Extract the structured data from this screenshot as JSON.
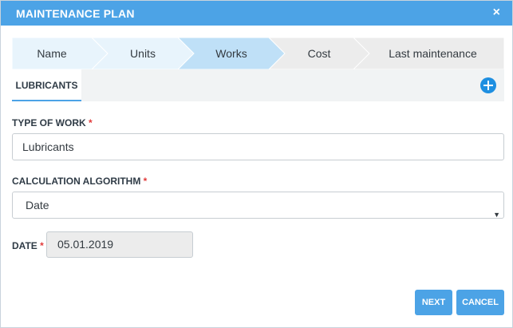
{
  "dialog": {
    "title": "MAINTENANCE PLAN",
    "close_icon": "×"
  },
  "stepper": {
    "steps": [
      {
        "label": "Name",
        "state": "completed"
      },
      {
        "label": "Units",
        "state": "completed"
      },
      {
        "label": "Works",
        "state": "active"
      },
      {
        "label": "Cost",
        "state": "pending"
      },
      {
        "label": "Last maintenance",
        "state": "pending"
      }
    ],
    "colors": {
      "completed": "#e8f4fc",
      "active": "#bfe0f7",
      "pending": "#ececec"
    }
  },
  "tabs": {
    "items": [
      {
        "label": "LUBRICANTS"
      }
    ],
    "add_icon": "plus-circle-icon"
  },
  "form": {
    "type_of_work": {
      "label": "TYPE OF WORK",
      "required": "*",
      "value": "Lubricants"
    },
    "calculation_algorithm": {
      "label": "CALCULATION ALGORITHM",
      "required": "*",
      "value": "Date",
      "arrow": "▼"
    },
    "date": {
      "label": "DATE",
      "required": "*",
      "value": "05.01.2019"
    }
  },
  "buttons": {
    "next": "NEXT",
    "cancel": "CANCEL"
  },
  "colors": {
    "accent": "#4ca3e6",
    "required": "#e23b3b"
  }
}
